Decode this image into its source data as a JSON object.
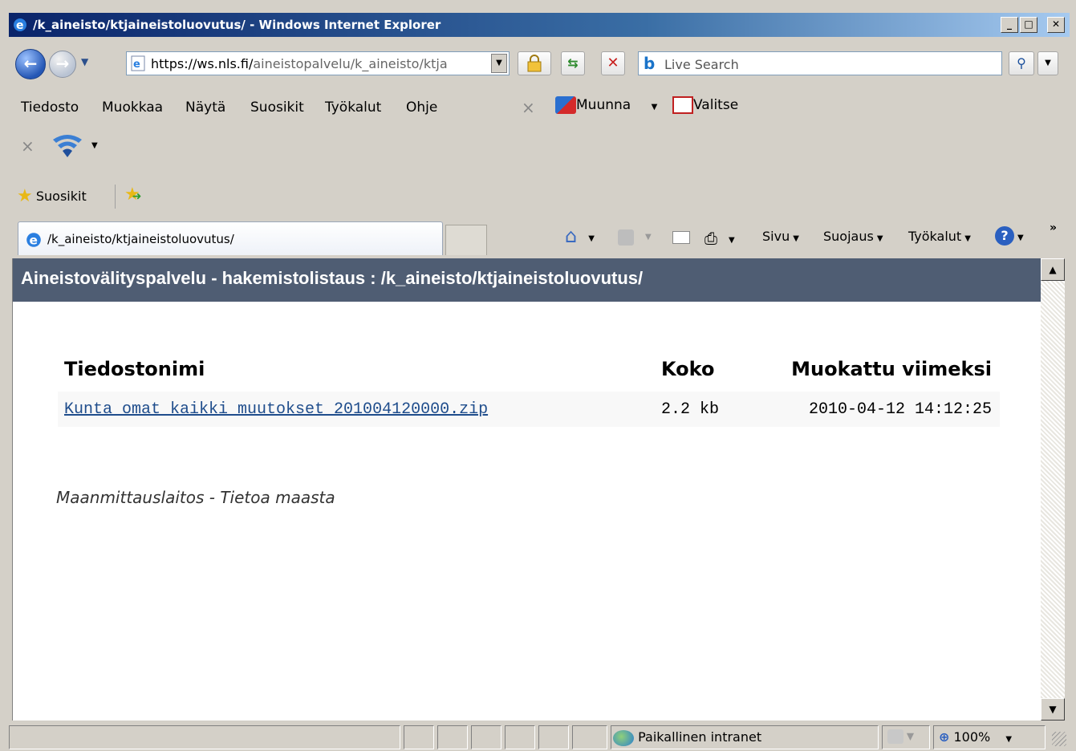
{
  "window": {
    "title": "/k_aineisto/ktjaineistoluovutus/ - Windows Internet Explorer",
    "controls": [
      "_",
      "□",
      "✕"
    ]
  },
  "address_bar": {
    "url_protocol": "https",
    "url_host": "://ws.nls.fi/",
    "url_path": "aineistopalvelu/k_aineisto/ktja",
    "search_placeholder": "Live Search"
  },
  "menu": {
    "items": [
      "Tiedosto",
      "Muokkaa",
      "Näytä",
      "Suosikit",
      "Työkalut",
      "Ohje"
    ],
    "addon_convert": "Muunna",
    "addon_select": "Valitse"
  },
  "favorites_bar": {
    "label": "Suosikit"
  },
  "tab": {
    "title": "/k_aineisto/ktjaineistoluovutus/"
  },
  "command_bar": {
    "page": "Sivu",
    "safety": "Suojaus",
    "tools": "Työkalut"
  },
  "page": {
    "header": "Aineistovälityspalvelu - hakemistolistaus : /k_aineisto/ktjaineistoluovutus/",
    "table": {
      "columns": [
        "Tiedostonimi",
        "Koko",
        "Muokattu viimeksi"
      ],
      "rows": [
        {
          "name": "Kunta_omat_kaikki_muutokset_201004120000.zip",
          "size": "2.2 kb",
          "modified": "2010-04-12 14:12:25"
        }
      ]
    },
    "footer": "Maanmittauslaitos - Tietoa maasta"
  },
  "status_bar": {
    "zone": "Paikallinen intranet",
    "zoom": "100%"
  }
}
